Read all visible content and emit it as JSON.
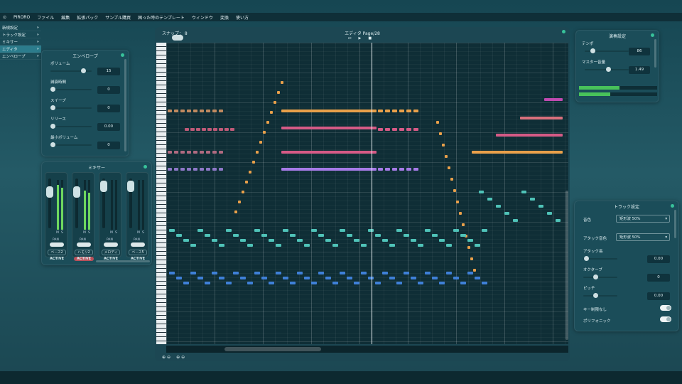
{
  "menu": [
    "PIRORO",
    "ファイル",
    "編集",
    "拡張パック",
    "サンプル購買",
    "困った時のテンプレート",
    "ウィンドウ",
    "変換",
    "使い方"
  ],
  "nav": [
    "新規設定",
    "トラック設定",
    "ミキサー",
    "エディタ",
    "エンベロープ"
  ],
  "envelope": {
    "title": "エンベロープ",
    "rows": [
      {
        "label": "ボリューム",
        "value": "15",
        "pos": 0.85
      },
      {
        "label": "減衰時間",
        "value": "0",
        "pos": 0.0
      },
      {
        "label": "スイープ",
        "value": "0",
        "pos": 0.0
      },
      {
        "label": "リリース",
        "value": "0.00",
        "pos": 0.0
      },
      {
        "label": "最小ボリューム",
        "value": "0",
        "pos": 0.0
      }
    ]
  },
  "mixer": {
    "title": "ミキサー",
    "channels": [
      {
        "name": "ベース2",
        "fader": 0.2,
        "m1": 0.9,
        "m2": 0.85,
        "active": "ACTIVE",
        "red": false
      },
      {
        "name": "ハモリ2",
        "fader": 0.2,
        "m1": 0.78,
        "m2": 0.75,
        "active": "ACTIVE",
        "red": true
      },
      {
        "name": "メロディ",
        "fader": 0.05,
        "m1": 0.0,
        "m2": 0.0,
        "active": "ACTIVE",
        "red": false
      },
      {
        "name": "ベース5",
        "fader": 0.05,
        "m1": 0.0,
        "m2": 0.0,
        "active": "ACTIVE",
        "red": false
      }
    ],
    "pan": "PAN",
    "m": "M",
    "s": "S"
  },
  "editor": {
    "title": "エディタ Page/28",
    "snap": "スナップ： 8"
  },
  "play": {
    "title": "演奏設定",
    "tempo": {
      "label": "テンポ",
      "value": "86",
      "pos": 0.15
    },
    "master": {
      "label": "マスター音量",
      "value": "1.49",
      "pos": 0.55
    }
  },
  "track": {
    "title": "トラック設定",
    "tone_label": "音色",
    "tone": "矩形波 50%",
    "attack_tone_label": "アタック音色",
    "attack_tone": "矩形波 50%",
    "rows": [
      {
        "label": "アタック長",
        "value": "0.00",
        "pos": 0.02
      },
      {
        "label": "オクターブ",
        "value": "0",
        "pos": 0.35
      },
      {
        "label": "ピッチ",
        "value": "0.00",
        "pos": 0.35
      }
    ],
    "toggle1": "キー制限なし",
    "toggle2": "ポリフォニック"
  },
  "colors": {
    "orange": "#e9a04a",
    "pink": "#d65a86",
    "purple": "#a77be8",
    "teal": "#4fc3b8",
    "blue": "#3f80d8",
    "salmon": "#d9707c",
    "magenta": "#c04ab0"
  }
}
